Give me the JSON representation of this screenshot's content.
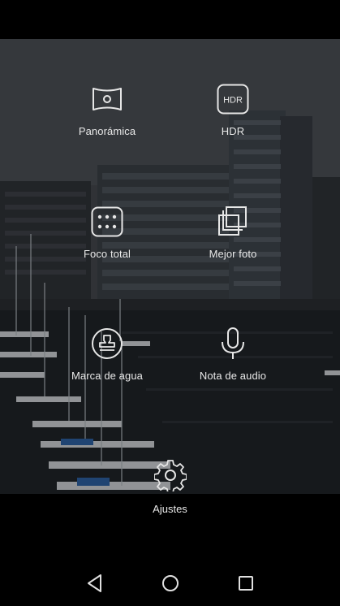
{
  "modes": [
    {
      "label": "Panorámica",
      "icon": "panorama-icon"
    },
    {
      "label": "HDR",
      "icon": "hdr-icon",
      "badge": "HDR"
    },
    {
      "label": "Foco total",
      "icon": "all-focus-icon"
    },
    {
      "label": "Mejor foto",
      "icon": "best-photo-icon"
    },
    {
      "label": "Marca de agua",
      "icon": "watermark-stamp-icon"
    },
    {
      "label": "Nota de audio",
      "icon": "microphone-icon"
    }
  ],
  "settings": {
    "label": "Ajustes",
    "icon": "gear-icon"
  },
  "nav": {
    "back_icon": "back-triangle-icon",
    "home_icon": "home-circle-icon",
    "recent_icon": "recent-square-icon"
  }
}
